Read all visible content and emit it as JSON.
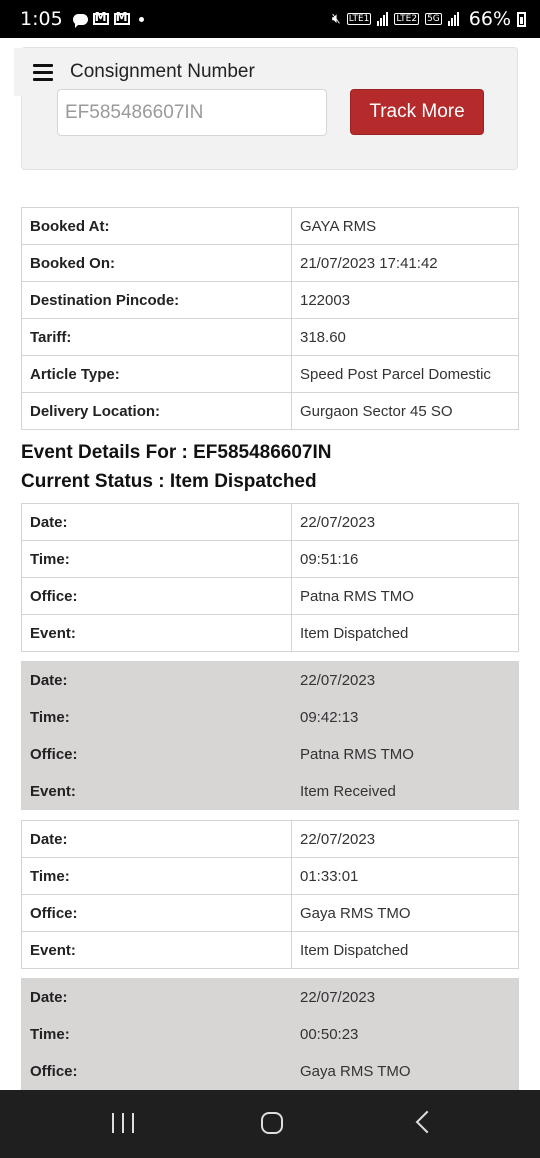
{
  "status_bar": {
    "time": "1:05",
    "lte1": "LTE1",
    "lte2": "LTE2",
    "network": "5G",
    "battery": "66%"
  },
  "header": {
    "title": "Consignment Number"
  },
  "search": {
    "consignment_value": "EF585486607IN",
    "track_button": "Track More"
  },
  "booking": [
    {
      "label": "Booked At:",
      "value": "GAYA RMS"
    },
    {
      "label": "Booked On:",
      "value": "21/07/2023 17:41:42"
    },
    {
      "label": "Destination Pincode:",
      "value": "122003"
    },
    {
      "label": "Tariff:",
      "value": "318.60"
    },
    {
      "label": "Article Type:",
      "value": "Speed Post Parcel Domestic"
    },
    {
      "label": "Delivery Location:",
      "value": "Gurgaon Sector 45 SO"
    }
  ],
  "event_heading": "Event Details For : EF585486607IN",
  "status_heading": "Current Status : Item Dispatched",
  "event_labels": {
    "date": "Date:",
    "time": "Time:",
    "office": "Office:",
    "event": "Event:"
  },
  "events": [
    {
      "date": "22/07/2023",
      "time": "09:51:16",
      "office": "Patna RMS TMO",
      "event": "Item Dispatched"
    },
    {
      "date": "22/07/2023",
      "time": "09:42:13",
      "office": "Patna RMS TMO",
      "event": "Item Received"
    },
    {
      "date": "22/07/2023",
      "time": "01:33:01",
      "office": "Gaya RMS TMO",
      "event": "Item Dispatched"
    },
    {
      "date": "22/07/2023",
      "time": "00:50:23",
      "office": "Gaya RMS TMO"
    }
  ]
}
